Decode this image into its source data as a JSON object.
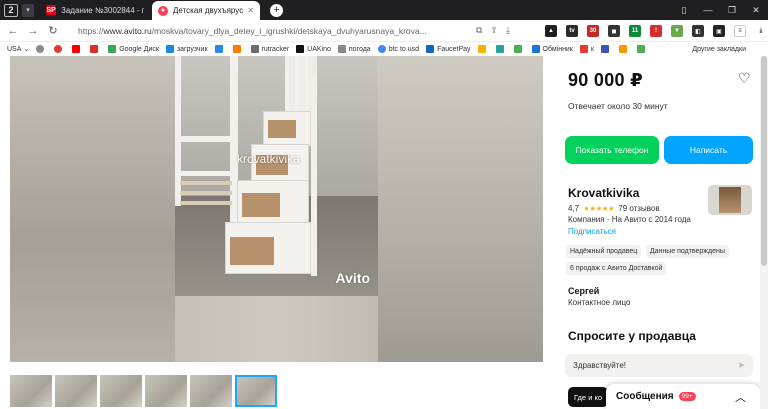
{
  "browser": {
    "tab_count": "2",
    "tabs": [
      {
        "title": "Задание №3002844 - про",
        "favicon": "SP",
        "active": false
      },
      {
        "title": "Детская двухъярусная к",
        "favicon": "A",
        "active": true
      }
    ],
    "url_prefix": "https://",
    "url_host": "www.avito.ru",
    "url_path": "/moskva/tovary_dlya_detey_i_igrushki/detskaya_dvuhyarusnaya_krova...",
    "bookmarks": [
      "USA",
      "",
      "",
      "",
      "",
      "Google Диск",
      "загрузчик",
      "",
      "",
      "rutracker",
      "UAKino",
      "погода",
      "btc to usd",
      "FaucetPay",
      "",
      "",
      "",
      "Обмінник",
      "к"
    ],
    "bookmarks_more": "Другие закладки"
  },
  "gallery": {
    "watermark": "krovatkivika",
    "logo": "Avito",
    "thumbnail_count": 6,
    "selected_thumbnail": 6
  },
  "listing": {
    "price": "90 000 ₽",
    "reply_time": "Отвечает около 30 минут",
    "phone_button": "Показать телефон",
    "write_button": "Написать",
    "seller_name": "Krovatkivika",
    "rating_value": "4,7",
    "stars": "★★★★★",
    "reviews": "79 отзывов",
    "company": "Компания · На Авито с 2014 года",
    "subscribe": "Подписаться",
    "badges": [
      "Надёжный продавец",
      "Данные подтверждены",
      "6 продаж с Авито Доставкой"
    ],
    "contact_name": "Сергей",
    "contact_role": "Контактное лицо",
    "ask_heading": "Спросите у продавца",
    "message_placeholder": "Здравствуйте!",
    "chip": "Где и ко",
    "chat_label": "Сообщения",
    "chat_count": "99+"
  },
  "colors": {
    "green": "#02d15c",
    "blue": "#00a5ff",
    "link": "#009cf0",
    "star": "#ffb021"
  }
}
